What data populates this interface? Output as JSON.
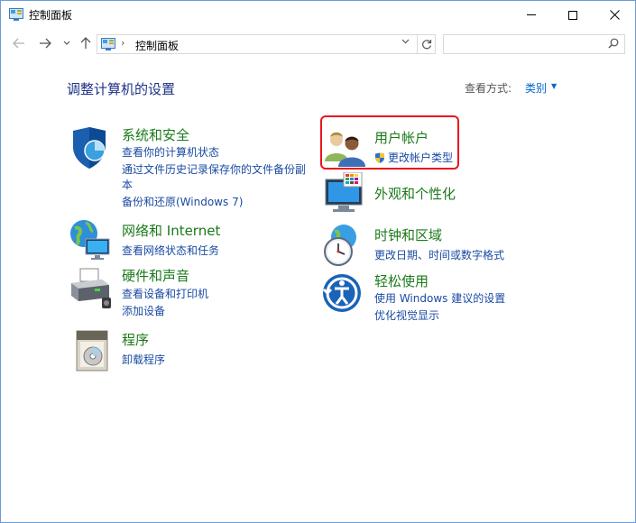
{
  "window": {
    "title": "控制面板",
    "controls": {
      "minimize": "minimize-icon",
      "maximize": "maximize-icon",
      "close": "close-icon"
    }
  },
  "nav": {
    "back_icon": "arrow-left-icon",
    "forward_icon": "arrow-right-icon",
    "recent_icon": "chevron-down-icon",
    "up_icon": "arrow-up-icon",
    "address": "控制面板",
    "refresh_icon": "refresh-icon",
    "search_placeholder": "",
    "search_icon": "search-icon"
  },
  "main": {
    "heading": "调整计算机的设置",
    "view_by_label": "查看方式:",
    "view_by_value": "类别"
  },
  "categories": [
    {
      "icon": "shield-icon",
      "title": "系统和安全",
      "links": [
        "查看你的计算机状态",
        "通过文件历史记录保存你的文件备份副",
        "本",
        "备份和还原(Windows 7)"
      ]
    },
    {
      "icon": "network-globe-icon",
      "title": "网络和 Internet",
      "links": [
        "查看网络状态和任务"
      ]
    },
    {
      "icon": "printer-icon",
      "title": "硬件和声音",
      "links": [
        "查看设备和打印机",
        "添加设备"
      ]
    },
    {
      "icon": "programs-icon",
      "title": "程序",
      "links": [
        "卸载程序"
      ]
    },
    {
      "icon": "users-icon",
      "title": "用户帐户",
      "links": [
        "更改帐户类型"
      ]
    },
    {
      "icon": "display-palette-icon",
      "title": "外观和个性化",
      "links": []
    },
    {
      "icon": "clock-globe-icon",
      "title": "时钟和区域",
      "links": [
        "更改日期、时间或数字格式"
      ]
    },
    {
      "icon": "ease-of-access-icon",
      "title": "轻松使用",
      "links": [
        "使用 Windows 建议的设置",
        "优化视觉显示"
      ]
    }
  ],
  "colors": {
    "heading": "#1e3287",
    "category_title": "#1a7a1a",
    "link": "#1a4ba3",
    "highlight_border": "#e8141d"
  }
}
